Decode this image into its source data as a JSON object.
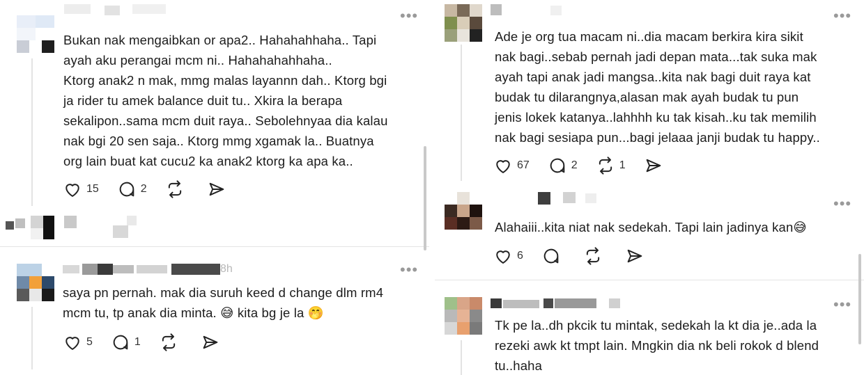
{
  "left": {
    "posts": [
      {
        "text": "Bukan nak mengaibkan or apa2.. Hahahahhaha.. Tapi\nayah aku perangai mcm ni.. Hahahahahhaha..\nKtorg anak2 n mak, mmg malas layannn dah.. Ktorg bgi\nja rider tu amek balance duit tu.. Xkira la berapa\nsekalipon..sama mcm duit raya.. Sebolehnyaa dia kalau\nnak bgi 20 sen saja.. Ktorg mmg xgamak la.. Buatnya\norg lain buat kat cucu2 ka anak2 ktorg ka apa ka..",
        "likes": "15",
        "replies": "2",
        "reposts": "",
        "more": "•••"
      },
      {
        "meta_suffix": "8h",
        "text": "saya pn pernah. mak dia suruh keed d change dlm rm4\nmcm tu, tp anak dia minta. 😅 kita bg je la 🤭",
        "likes": "5",
        "replies": "1",
        "reposts": "",
        "more": "•••"
      }
    ]
  },
  "right": {
    "posts": [
      {
        "text": "Ade je org tua macam ni..dia macam berkira kira sikit\nnak bagi..sebab pernah jadi depan mata...tak suka mak\nayah tapi anak jadi mangsa..kita nak bagi duit raya kat\nbudak tu dilarangnya,alasan mak ayah budak tu pun\njenis lokek katanya..lahhhh ku tak kisah..ku tak memilih\nnak bagi sesiapa pun...bagi jelaaa janji budak tu happy..",
        "likes": "67",
        "replies": "2",
        "reposts": "1",
        "more": "•••"
      },
      {
        "text": "Alahaiii..kita niat nak sedekah. Tapi lain jadinya kan😅",
        "likes": "6",
        "replies": "",
        "reposts": "",
        "more": "•••"
      },
      {
        "text": "Tk pe la..dh pkcik tu mintak, sedekah la kt dia je..ada la\nrezeki awk kt tmpt lain. Mngkin dia nk beli rokok d blend\ntu..haha",
        "more": "•••"
      }
    ]
  },
  "icons": {
    "like": "heart-icon",
    "reply": "speech-bubble-icon",
    "repost": "repost-arrows-icon",
    "share": "send-arrow-icon",
    "more": "more-horizontal-icon"
  },
  "colors": {
    "text": "#1c1c1c",
    "muted": "#9a9a9a",
    "divider": "#e4e4e4",
    "icon": "#222222"
  }
}
